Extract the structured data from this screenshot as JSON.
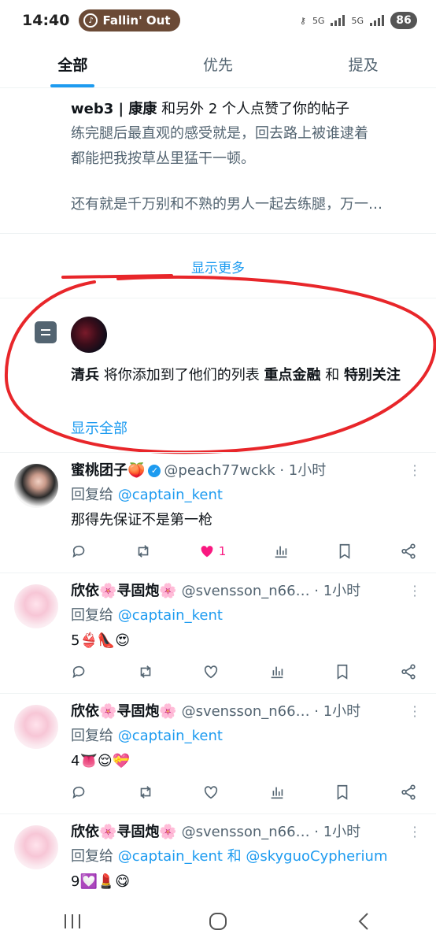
{
  "status": {
    "time": "14:40",
    "media_title": "Fallin' Out",
    "net1": "5G",
    "net2": "5G",
    "battery": "86"
  },
  "tabs": [
    "全部",
    "优先",
    "提及"
  ],
  "liked_notification": {
    "actor": "web3 | 康康",
    "action": "和另外 2 个人点赞了你的帖子",
    "line1": "练完腿后最直观的感受就是，回去路上被谁逮着",
    "line2": "都能把我按草丛里猛干一顿。",
    "line3": "还有就是千万别和不熟的男人一起去练腿，万一…",
    "show_more": "显示更多"
  },
  "list_notification": {
    "actor": "清兵",
    "action": "将你添加到了他们的列表",
    "list1": "重点金融",
    "conj": "和",
    "list2": "特别关注",
    "show_all": "显示全部"
  },
  "tweets": [
    {
      "name": "蜜桃团子🍑",
      "handle": "@peach77wckk · 1小时",
      "reply_label": "回复给",
      "reply_to": "@captain_kent",
      "text": "那得先保证不是第一枪",
      "likes": "1"
    },
    {
      "name": "欣依🌸寻固炮🌸",
      "handle": "@svensson_n66… · 1小时",
      "reply_label": "回复给",
      "reply_to": "@captain_kent",
      "text": "5👙👠😍",
      "likes": ""
    },
    {
      "name": "欣依🌸寻固炮🌸",
      "handle": "@svensson_n66… · 1小时",
      "reply_label": "回复给",
      "reply_to": "@captain_kent",
      "text": "4👅😌💝",
      "likes": ""
    },
    {
      "name": "欣依🌸寻固炮🌸",
      "handle": "@svensson_n66… · 1小时",
      "reply_label": "回复给",
      "reply_to": "@captain_kent 和 @skyguoCypherium",
      "text": "9💟💄😋",
      "likes": ""
    }
  ],
  "colors": {
    "accent": "#1d9bf0",
    "like": "#f91880",
    "annotation": "#e8262a"
  }
}
